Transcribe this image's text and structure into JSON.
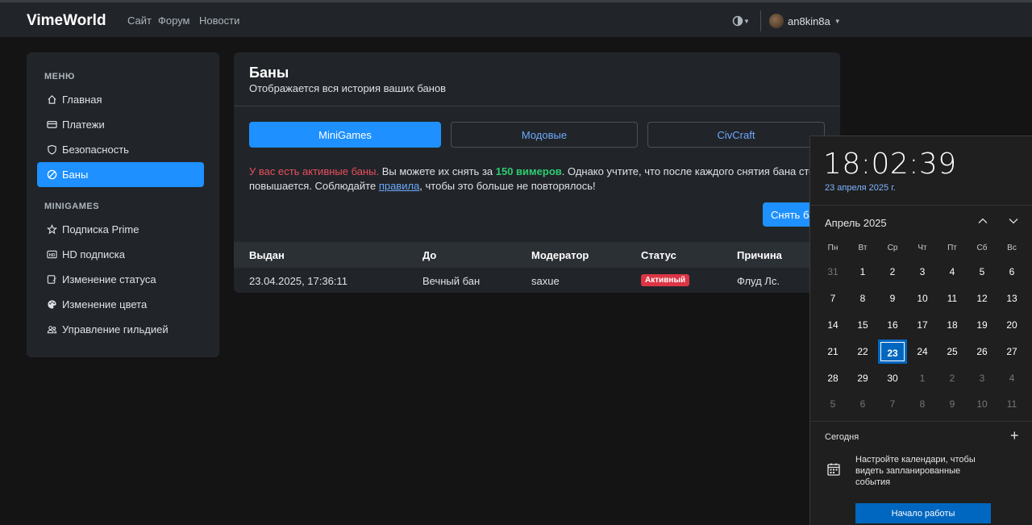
{
  "header": {
    "brand": "VimeWorld",
    "nav": [
      "Сайт",
      "Форум",
      "Новости"
    ],
    "username": "an8kin8a"
  },
  "sidebar": {
    "sections": [
      {
        "heading": "МЕНЮ",
        "items": [
          {
            "label": "Главная",
            "icon": "home-icon"
          },
          {
            "label": "Платежи",
            "icon": "credit-card-icon"
          },
          {
            "label": "Безопасность",
            "icon": "shield-icon"
          },
          {
            "label": "Баны",
            "icon": "ban-icon",
            "active": true
          }
        ]
      },
      {
        "heading": "MINIGAMES",
        "items": [
          {
            "label": "Подписка Prime",
            "icon": "star-icon"
          },
          {
            "label": "HD подписка",
            "icon": "hd-icon"
          },
          {
            "label": "Изменение статуса",
            "icon": "edit-status-icon"
          },
          {
            "label": "Изменение цвета",
            "icon": "palette-icon"
          },
          {
            "label": "Управление гильдией",
            "icon": "people-icon"
          }
        ]
      }
    ]
  },
  "main": {
    "title": "Баны",
    "subtitle": "Отображается вся история ваших банов",
    "tabs": [
      "MiniGames",
      "Модовые",
      "CivCraft"
    ],
    "notice": {
      "red": "У вас есть активные баны.",
      "part1": " Вы можете их снять за ",
      "price": "150 вимеров",
      "part2": ". Однако учтите, что после каждого снятия бана стоимость",
      "part3": "повышается. Соблюдайте ",
      "link": "правила",
      "part4": ", чтобы это больше не повторялось!"
    },
    "unban_button": "Снять бан",
    "table": {
      "headers": [
        "Выдан",
        "До",
        "Модератор",
        "Статус",
        "Причина"
      ],
      "row": {
        "issued": "23.04.2025, 17:36:11",
        "until": "Вечный бан",
        "moderator": "saxue",
        "status": "Активный",
        "reason": "Флуд Лс."
      }
    }
  },
  "calendar": {
    "time": "18:02:39",
    "date": "23 апреля 2025 г.",
    "month": "Апрель 2025",
    "weekdays": [
      "Пн",
      "Вт",
      "Ср",
      "Чт",
      "Пт",
      "Сб",
      "Вс"
    ],
    "days": [
      [
        "31",
        "1",
        "2",
        "3",
        "4",
        "5",
        "6"
      ],
      [
        "7",
        "8",
        "9",
        "10",
        "11",
        "12",
        "13"
      ],
      [
        "14",
        "15",
        "16",
        "17",
        "18",
        "19",
        "20"
      ],
      [
        "21",
        "22",
        "23",
        "24",
        "25",
        "26",
        "27"
      ],
      [
        "28",
        "29",
        "30",
        "1",
        "2",
        "3",
        "4"
      ],
      [
        "5",
        "6",
        "7",
        "8",
        "9",
        "10",
        "11"
      ]
    ],
    "today_label": "Сегодня",
    "message": "Настройте календари, чтобы видеть запланированные события",
    "start_button": "Начало работы"
  }
}
